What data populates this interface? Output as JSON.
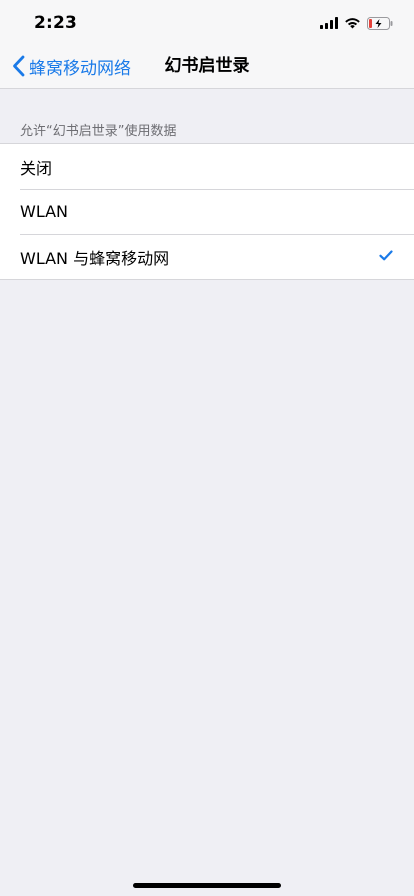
{
  "status_bar": {
    "time": "2:23"
  },
  "nav": {
    "back_label": "蜂窝移动网络",
    "title": "幻书启世录"
  },
  "section": {
    "header": "允许“幻书启世录”使用数据"
  },
  "options": [
    {
      "label": "关闭",
      "selected": false
    },
    {
      "label": "WLAN",
      "selected": false
    },
    {
      "label": "WLAN 与蜂窝移动网",
      "selected": true
    }
  ],
  "colors": {
    "accent": "#1a7ae8",
    "background": "#efeff4",
    "battery_low": "#e5423b"
  },
  "icons": {
    "back": "chevron-left-icon",
    "signal": "cellular-signal-icon",
    "wifi": "wifi-icon",
    "battery": "battery-charging-icon",
    "check": "checkmark-icon"
  }
}
